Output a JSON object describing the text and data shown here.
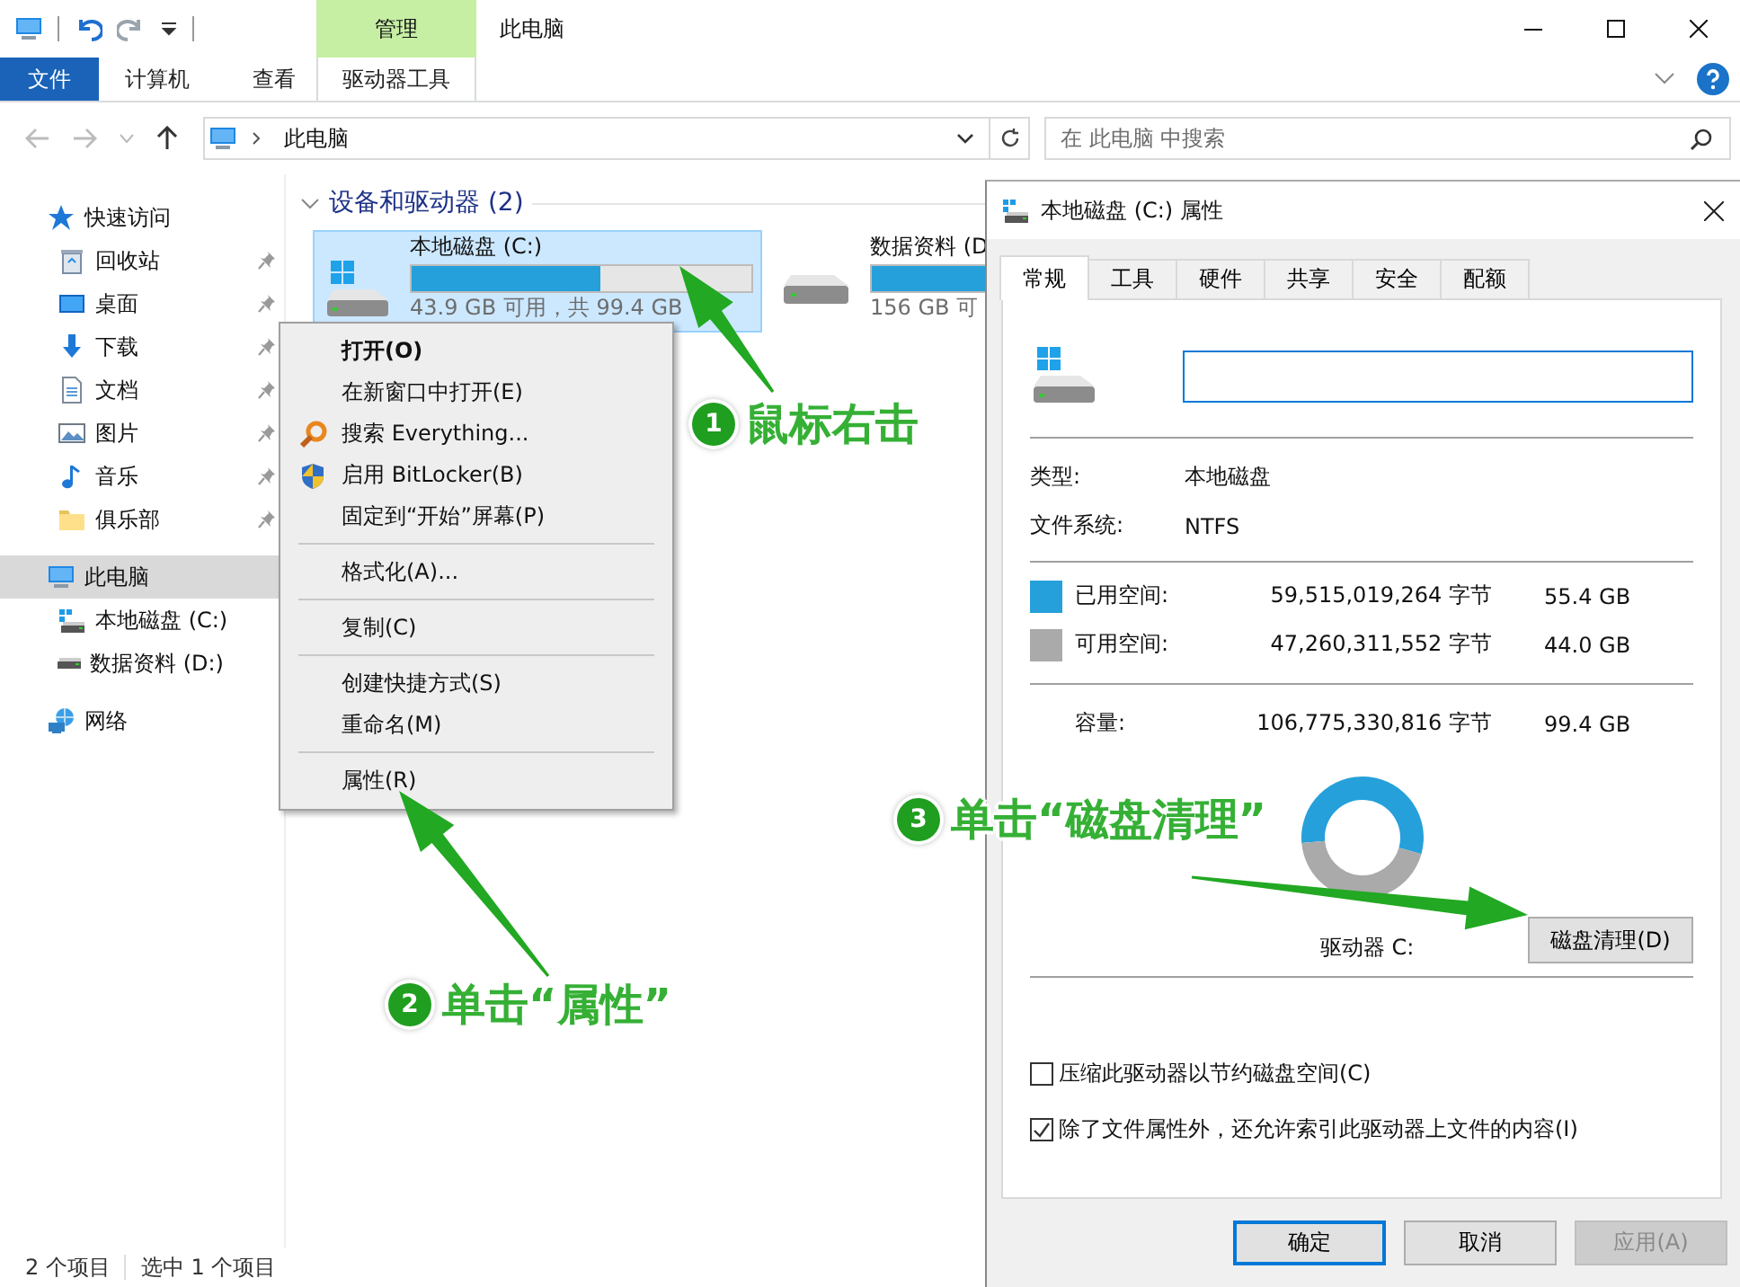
{
  "title_bar": {
    "contextual_tab": "管理",
    "title": "此电脑"
  },
  "ribbon": {
    "tabs": [
      {
        "label": "文件",
        "kind": "file"
      },
      {
        "label": "计算机",
        "kind": "tab"
      },
      {
        "label": "查看",
        "kind": "tab"
      },
      {
        "label": "驱动器工具",
        "kind": "contextual"
      }
    ]
  },
  "address_bar": {
    "path": "此电脑"
  },
  "search": {
    "placeholder": "在 此电脑 中搜索"
  },
  "sidebar": {
    "items": [
      {
        "label": "快速访问",
        "selected": false,
        "children": [
          {
            "label": "回收站",
            "pinned": true,
            "selected": false
          },
          {
            "label": "桌面",
            "pinned": true,
            "selected": false
          },
          {
            "label": "下载",
            "pinned": true,
            "selected": false
          },
          {
            "label": "文档",
            "pinned": true,
            "selected": false
          },
          {
            "label": "图片",
            "pinned": true,
            "selected": false
          },
          {
            "label": "音乐",
            "pinned": true,
            "selected": false
          },
          {
            "label": "俱乐部",
            "pinned": true,
            "selected": false
          }
        ]
      },
      {
        "label": "此电脑",
        "selected": true,
        "children": [
          {
            "label": "本地磁盘 (C:)",
            "pinned": false,
            "selected": false
          },
          {
            "label": "数据资料 (D:)",
            "pinned": false,
            "selected": false
          }
        ]
      },
      {
        "label": "网络",
        "selected": false
      }
    ]
  },
  "content": {
    "group": {
      "title": "设备和驱动器 (2)",
      "expanded": true
    },
    "drives": [
      {
        "name": "本地磁盘 (C:)",
        "level": 0.557,
        "free": "43.9 GB 可用，共 99.4 GB",
        "selected": true
      },
      {
        "name": "数据资料 (D",
        "level": 0.45,
        "free": "156 GB 可",
        "selected": false
      }
    ]
  },
  "context_menu": {
    "items": [
      {
        "kind": "item",
        "label": "打开(O)",
        "default": true
      },
      {
        "kind": "item",
        "label": "在新窗口中打开(E)",
        "default": false
      },
      {
        "kind": "item",
        "label": "搜索 Everything...",
        "default": false
      },
      {
        "kind": "item",
        "label": "启用 BitLocker(B)",
        "default": false
      },
      {
        "kind": "item",
        "label": "固定到“开始”屏幕(P)",
        "default": false
      },
      {
        "kind": "separator"
      },
      {
        "kind": "item",
        "label": "格式化(A)...",
        "default": false
      },
      {
        "kind": "separator"
      },
      {
        "kind": "item",
        "label": "复制(C)",
        "default": false
      },
      {
        "kind": "separator"
      },
      {
        "kind": "item",
        "label": "创建快捷方式(S)",
        "default": false
      },
      {
        "kind": "item",
        "label": "重命名(M)",
        "default": false
      },
      {
        "kind": "separator"
      },
      {
        "kind": "item",
        "label": "属性(R)",
        "default": false
      }
    ]
  },
  "status_bar": {
    "count": "2 个项目",
    "selection": "选中 1 个项目"
  },
  "properties_dialog": {
    "title": "本地磁盘 (C:) 属性",
    "tabs": [
      {
        "label": "常规",
        "selected": true
      },
      {
        "label": "工具",
        "selected": false
      },
      {
        "label": "硬件",
        "selected": false
      },
      {
        "label": "共享",
        "selected": false
      },
      {
        "label": "安全",
        "selected": false
      },
      {
        "label": "配额",
        "selected": false
      }
    ],
    "info": [
      {
        "label": "类型:",
        "value": "本地磁盘"
      },
      {
        "label": "文件系统:",
        "value": "NTFS"
      }
    ],
    "space": [
      {
        "label": "已用空间:",
        "color": "#26a0da",
        "bytes": "59,515,019,264 字节",
        "size": "55.4 GB"
      },
      {
        "label": "可用空间:",
        "color": "#aaaaaa",
        "bytes": "47,260,311,552 字节",
        "size": "44.0 GB"
      }
    ],
    "capacity": {
      "label": "容量:",
      "bytes": "106,775,330,816 字节",
      "size": "99.4 GB"
    },
    "chart_data": {
      "type": "donut",
      "values": [
        55.4,
        44.0
      ]
    },
    "drive_label": "驱动器 C:",
    "cleanup_button": "磁盘清理(D)",
    "options": [
      {
        "label": "压缩此驱动器以节约磁盘空间(C)",
        "checked": false
      },
      {
        "label": "除了文件属性外，还允许索引此驱动器上文件的内容(I)",
        "checked": true
      }
    ],
    "buttons": [
      {
        "label": "确定",
        "default": true,
        "disabled": false
      },
      {
        "label": "取消",
        "default": false,
        "disabled": false
      },
      {
        "label": "应用(A)",
        "default": false,
        "disabled": true
      }
    ]
  },
  "annotations": [
    {
      "number": "1",
      "text": "鼠标右击"
    },
    {
      "number": "2",
      "text": "单击“属性”"
    },
    {
      "number": "3",
      "text": "单击“磁盘清理”"
    }
  ]
}
